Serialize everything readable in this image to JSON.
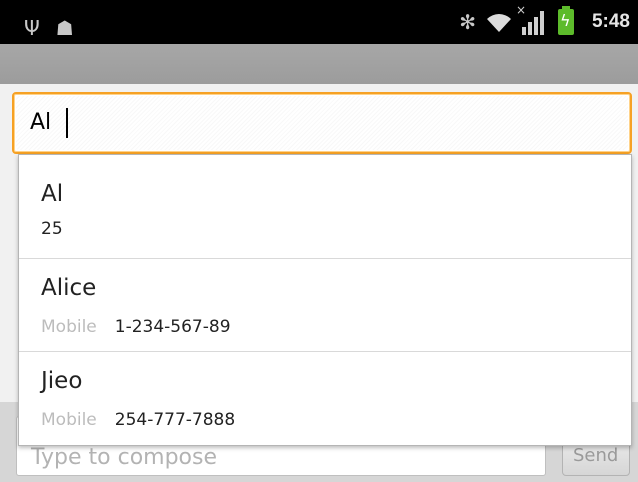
{
  "status_bar": {
    "time": "5:48",
    "left_icons": [
      "usb-icon",
      "android-debug-icon"
    ],
    "right_icons": [
      "bluetooth-icon",
      "wifi-icon",
      "signal-icon",
      "battery-charging-icon"
    ]
  },
  "recipient_field": {
    "value": "Al"
  },
  "suggestions": [
    {
      "name": "Al",
      "type": "",
      "detail": "25"
    },
    {
      "name": "Alice",
      "type": "Mobile",
      "detail": "1-234-567-89"
    },
    {
      "name": "Jieo",
      "type": "Mobile",
      "detail": "254-777-7888"
    }
  ],
  "compose": {
    "placeholder": "Type to compose",
    "send_label": "Send"
  },
  "colors": {
    "focus_border": "#f6a124",
    "status_bar_bg": "#000000",
    "title_bar_bg": "#a3a3a3",
    "secondary_text": "#bcbcbc"
  }
}
